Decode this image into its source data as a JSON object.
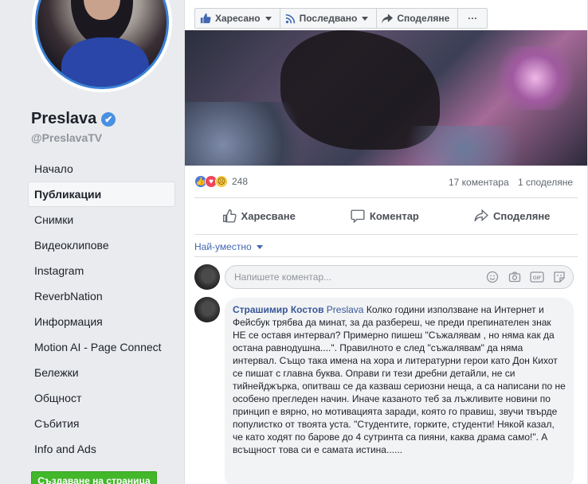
{
  "page": {
    "name": "Preslava",
    "handle": "@PreslavaTV",
    "verified_glyph": "✔"
  },
  "nav": {
    "items": [
      {
        "label": "Начало"
      },
      {
        "label": "Публикации"
      },
      {
        "label": "Снимки"
      },
      {
        "label": "Видеоклипове"
      },
      {
        "label": "Instagram"
      },
      {
        "label": "ReverbNation"
      },
      {
        "label": "Информация"
      },
      {
        "label": "Motion AI - Page Connect"
      },
      {
        "label": "Бележки"
      },
      {
        "label": "Общност"
      },
      {
        "label": "Събития"
      },
      {
        "label": "Info and Ads"
      }
    ],
    "active_index": 1
  },
  "create_page_label": "Създаване на страница",
  "topbar": {
    "liked_label": "Харесано",
    "following_label": "Последвано",
    "share_label": "Споделяне",
    "more_label": "···"
  },
  "post": {
    "reaction_count": "248",
    "comments_count": "17 коментара",
    "shares_count": "1 споделяне",
    "reaction_icons": [
      "like-icon",
      "love-icon",
      "sad-icon"
    ],
    "actions": {
      "like": "Харесване",
      "comment": "Коментар",
      "share": "Споделяне"
    },
    "sort_label": "Най-уместно"
  },
  "comment_input": {
    "placeholder": "Напишете коментар...",
    "icons": [
      "emoji-icon",
      "camera-icon",
      "gif-icon",
      "sticker-icon"
    ]
  },
  "comment": {
    "author": "Страшимир Костов",
    "mention": "Preslava",
    "text": "Колко години използване на Интернет и Фейсбук трябва да минат, за да разбереш, че преди препинателен знак НЕ се оставя интервал? Примерно пишеш \"Съжалявам , но няма как да остана равнодушна....\". Правилното е след \"съжалявам\" да няма интервал. Също така имена на хора и литературни герои като Дон Кихот се пишат с главна буква. Оправи ги тези дребни детайли, не си тийнейджърка, опитваш се да казваш сериозни неща, а са написани по не особено прегледен начин. Иначе казаното теб за лъжливите новини по принцип е вярно, но мотивацията заради, която го правиш, звучи твърде популистко от твоята уста. \"Студентите, горките, студенти! Някой казал, че като ходят по барове до 4 сутринта са пияни, каква драма само!\". А всъщност това си е самата истина......"
  },
  "colors": {
    "accent": "#4267b2",
    "link": "#385898",
    "create_button": "#42b72a",
    "verified": "#4a90e2",
    "background": "#e9ebee"
  }
}
